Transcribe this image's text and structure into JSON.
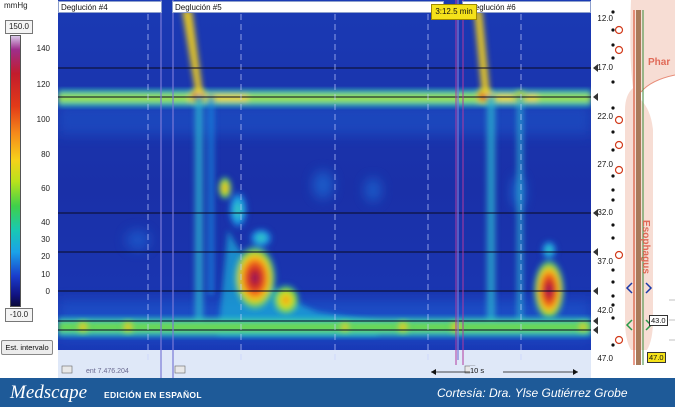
{
  "colorscale": {
    "unit": "mmHg",
    "max_box": "150.0",
    "min_box": "-10.0",
    "ticks": [
      "140",
      "120",
      "100",
      "80",
      "60",
      "40",
      "30",
      "20",
      "10",
      "0"
    ],
    "est_interval_button": "Est. intervalo"
  },
  "swallows": [
    {
      "label": "Deglución #4"
    },
    {
      "label": "Deglución #5"
    },
    {
      "label": "Deglución #6"
    }
  ],
  "time_marker": "3:12.5 min",
  "scale_bar": "10 s",
  "watermark": "ent 7.476.204",
  "anatomy": {
    "depths": [
      "12.0",
      "17.0",
      "22.0",
      "27.0",
      "32.0",
      "37.0",
      "42.0",
      "47.0"
    ],
    "labels": {
      "pharynx": "Phar",
      "esophagus": "Esophagus"
    },
    "badges": [
      "43.0",
      "47.0"
    ]
  },
  "footer": {
    "brand": "Medscape",
    "edition": "EDICIÓN EN ESPAÑOL",
    "credit": "Cortesía: Dra. Ylse Gutiérrez Grobe"
  },
  "colors": {
    "footer_bg": "#1e5a98",
    "plot_bg": "#1a2aa8",
    "marker": "#f5e21a"
  }
}
